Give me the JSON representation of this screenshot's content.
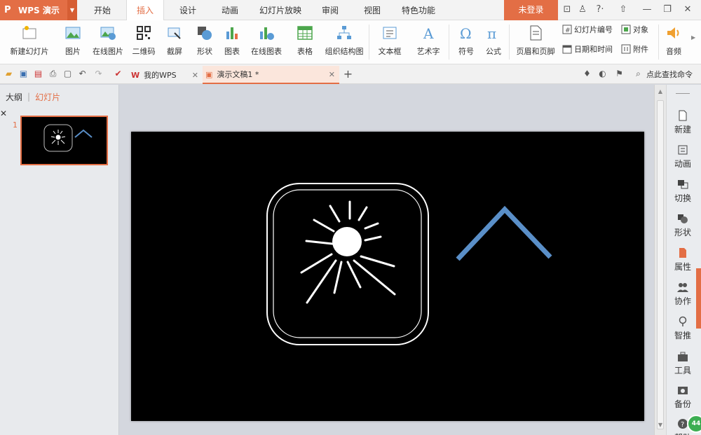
{
  "app": {
    "name": "WPS 演示",
    "login_label": "未登录"
  },
  "menu": [
    "开始",
    "插入",
    "设计",
    "动画",
    "幻灯片放映",
    "审阅",
    "视图",
    "特色功能"
  ],
  "active_menu": "插入",
  "ribbon": {
    "new_slide": "新建幻灯片",
    "picture": "图片",
    "online_picture": "在线图片",
    "qrcode": "二维码",
    "screenshot": "截屏",
    "shape": "形状",
    "chart": "图表",
    "online_chart": "在线图表",
    "table": "表格",
    "org_chart": "组织结构图",
    "textbox": "文本框",
    "wordart": "艺术字",
    "symbol": "符号",
    "formula": "公式",
    "header_footer": "页眉和页脚",
    "slide_number": "幻灯片编号",
    "date_time": "日期和时间",
    "object": "对象",
    "attachment": "附件",
    "audio": "音频"
  },
  "doc_tabs": [
    {
      "label": "我的WPS",
      "active": false
    },
    {
      "label": "演示文稿1 *",
      "active": true
    }
  ],
  "search_command": "点此查找命令",
  "left_panel": {
    "tab_outline": "大纲",
    "tab_slides": "幻灯片",
    "slide_number": "1"
  },
  "task_panel": [
    "新建",
    "动画",
    "切换",
    "形状",
    "属性",
    "协作",
    "智推",
    "工具",
    "备份",
    "帮助"
  ],
  "badge": "44",
  "colors": {
    "accent": "#e36e45",
    "slide_bg": "#000000",
    "chevron": "#5a8fc8",
    "icon_outline": "#ffffff"
  },
  "slide": {
    "shapes": [
      "rounded-square-outline-icon",
      "sun-icon",
      "chevron-up-shape"
    ]
  }
}
